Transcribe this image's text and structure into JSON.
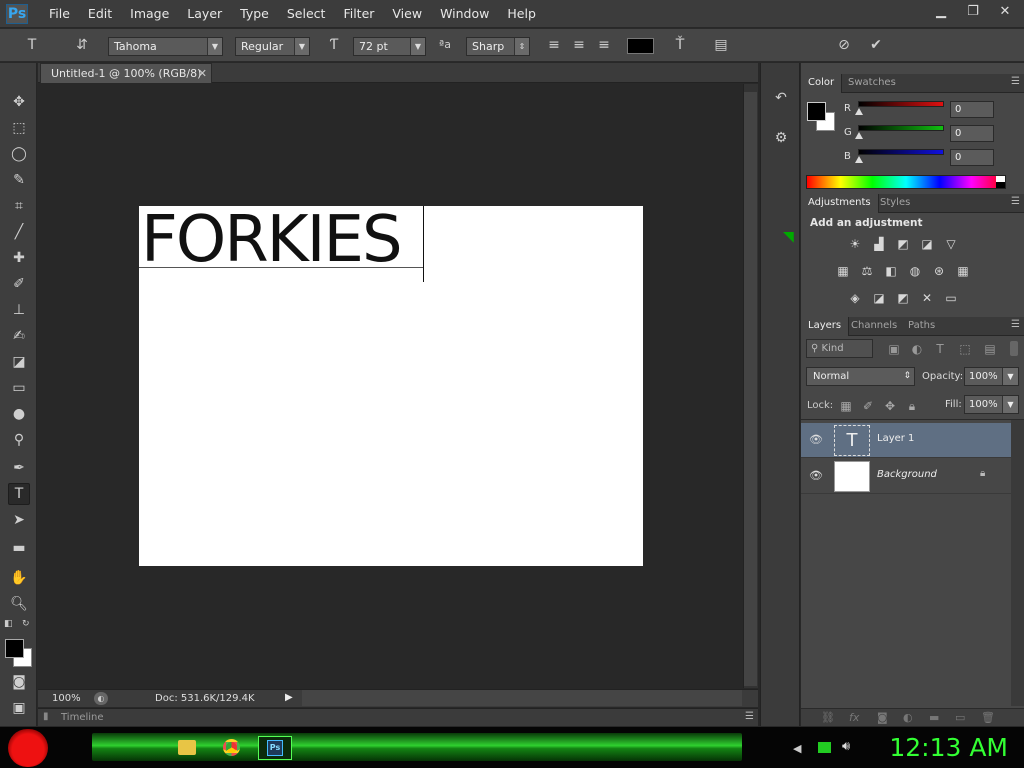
{
  "app": {
    "logo": "Ps"
  },
  "menu": [
    "File",
    "Edit",
    "Image",
    "Layer",
    "Type",
    "Select",
    "Filter",
    "View",
    "Window",
    "Help"
  ],
  "window_controls": {
    "minimize": "▁",
    "restore": "❐",
    "close": "✕"
  },
  "options": {
    "font_family": "Tahoma",
    "font_style": "Regular",
    "font_size": "72 pt",
    "antialias_label": "ªa",
    "antialias": "Sharp",
    "text_color": "#000000"
  },
  "document": {
    "tab_title": "Untitled-1 @ 100% (RGB/8)",
    "text": "FORKIES",
    "zoom": "100%",
    "doc_info": "Doc: 531.6K/129.4K",
    "timeline_label": "Timeline"
  },
  "color_panel": {
    "tabs": [
      "Color",
      "Swatches"
    ],
    "channels": [
      {
        "label": "R",
        "value": "0",
        "color": "#e01010"
      },
      {
        "label": "G",
        "value": "0",
        "color": "#10c010"
      },
      {
        "label": "B",
        "value": "0",
        "color": "#1010e0"
      }
    ],
    "foreground": "#000000",
    "background": "#ffffff"
  },
  "adjustments_panel": {
    "tabs": [
      "Adjustments",
      "Styles"
    ],
    "heading": "Add an adjustment"
  },
  "layers_panel": {
    "tabs": [
      "Layers",
      "Channels",
      "Paths"
    ],
    "filter_kind": "Kind",
    "blend_mode": "Normal",
    "opacity_label": "Opacity:",
    "opacity": "100%",
    "lock_label": "Lock:",
    "fill_label": "Fill:",
    "fill": "100%",
    "layers": [
      {
        "name": "Layer 1",
        "type": "text",
        "selected": true
      },
      {
        "name": "Background",
        "type": "background",
        "locked": true
      }
    ]
  },
  "taskbar": {
    "clock": "12:13 AM"
  }
}
